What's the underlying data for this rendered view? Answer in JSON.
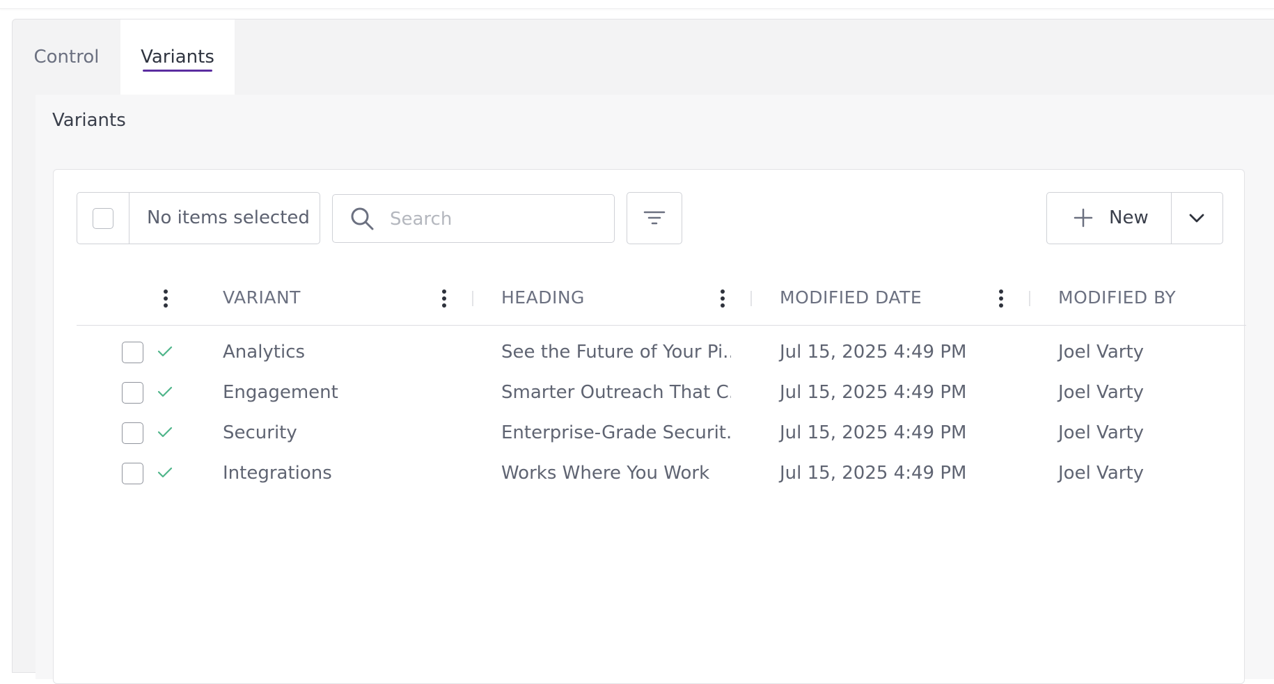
{
  "tabs": [
    {
      "label": "Control",
      "active": false
    },
    {
      "label": "Variants",
      "active": true
    }
  ],
  "section": {
    "title": "Variants"
  },
  "toolbar": {
    "selection_label": "No items selected",
    "search_placeholder": "Search",
    "new_label": "New"
  },
  "table": {
    "columns": [
      "VARIANT",
      "HEADING",
      "MODIFIED DATE",
      "MODIFIED BY"
    ],
    "rows": [
      {
        "variant": "Analytics",
        "heading": "See the Future of Your Pi...",
        "modified_date": "Jul 15, 2025 4:49 PM",
        "modified_by": "Joel Varty"
      },
      {
        "variant": "Engagement",
        "heading": "Smarter Outreach That C...",
        "modified_date": "Jul 15, 2025 4:49 PM",
        "modified_by": "Joel Varty"
      },
      {
        "variant": "Security",
        "heading": "Enterprise-Grade Securit...",
        "modified_date": "Jul 15, 2025 4:49 PM",
        "modified_by": "Joel Varty"
      },
      {
        "variant": "Integrations",
        "heading": "Works Where You Work",
        "modified_date": "Jul 15, 2025 4:49 PM",
        "modified_by": "Joel Varty"
      }
    ]
  },
  "colors": {
    "accent": "#5a2ca0",
    "check": "#4fb58a",
    "text": "#5f6472",
    "border": "#cfd1d6"
  },
  "icons": {
    "search": "search-icon",
    "filter": "filter-icon",
    "add": "plus-icon",
    "dropdown": "chevron-down-icon",
    "column_menu": "kebab-menu-icon",
    "published": "checkmark-icon"
  }
}
